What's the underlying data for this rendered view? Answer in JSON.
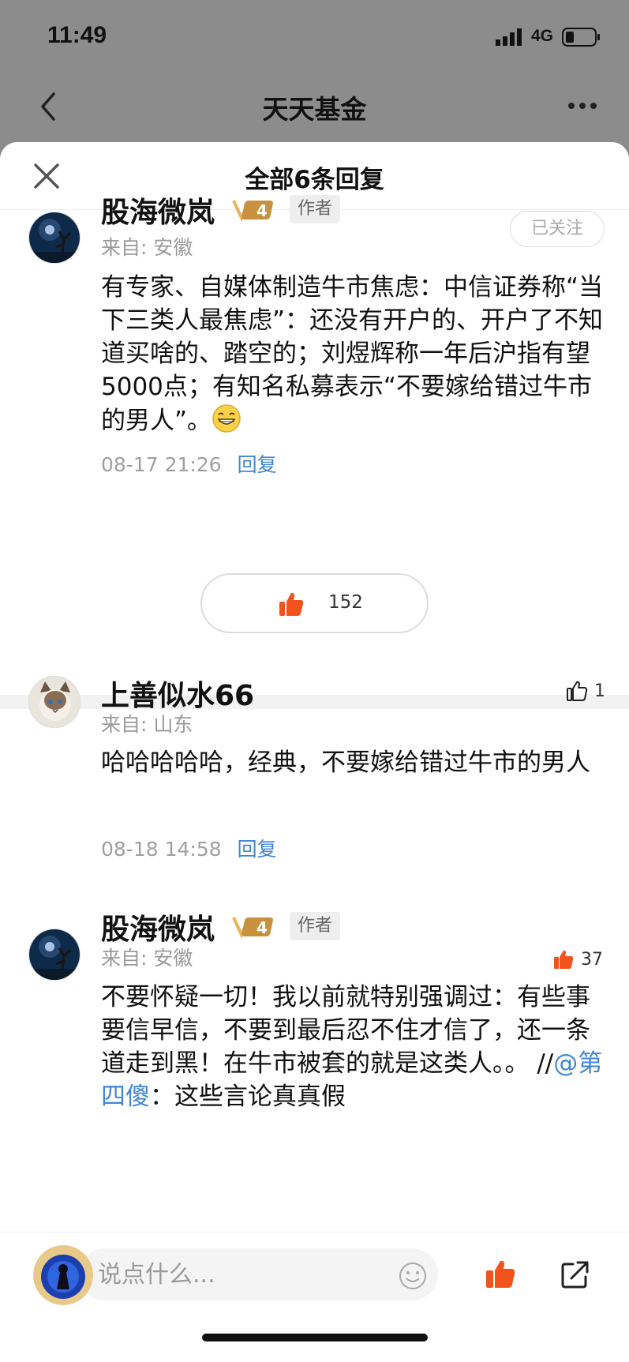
{
  "status_bar": {
    "time": "11:49",
    "network": "4G"
  },
  "nav": {
    "title": "天天基金"
  },
  "sheet": {
    "title": "全部6条回复"
  },
  "main_comment": {
    "username": "股海微岚",
    "level": "4",
    "author_tag": "作者",
    "follow_label": "已关注",
    "from": "来自: 安徽",
    "content": "有专家、自媒体制造牛市焦虑：中信证券称“当下三类人最焦虑”：还没有开户的、开户了不知道买啥的、踏空的；刘煜辉称一年后沪指有望5000点；有知名私募表示“不要嫁给错过牛市的男人”。",
    "time": "08-17 21:26",
    "reply_label": "回复",
    "likes": "152"
  },
  "replies": [
    {
      "username": "上善似水66",
      "from": "来自: 山东",
      "content": "哈哈哈哈哈，经典，不要嫁给错过牛市的男人",
      "time": "08-18 14:58",
      "reply_label": "回复",
      "likes": "1"
    },
    {
      "username": "股海微岚",
      "level": "4",
      "author_tag": "作者",
      "from": "来自: 安徽",
      "content_main": "不要怀疑一切！我以前就特别强调过：有些事要信早信，不要到最后忍不住才信了，还一条道走到黑！在牛市被套的就是这类人。。 //",
      "mention": "@第四傻",
      "content_tail": "：这些言论真真假",
      "likes": "37"
    }
  ],
  "bottom_bar": {
    "input_placeholder": "说点什么..."
  },
  "colors": {
    "accent_orange": "#f2521c",
    "link_blue": "#3f86d6",
    "overlay_gray": "#8c8c8c"
  },
  "icons": [
    "back-icon",
    "more-icon",
    "close-icon",
    "thumbs-up-icon",
    "thumbs-up-outline-icon",
    "emoji-icon",
    "share-icon",
    "grin-emoji"
  ]
}
